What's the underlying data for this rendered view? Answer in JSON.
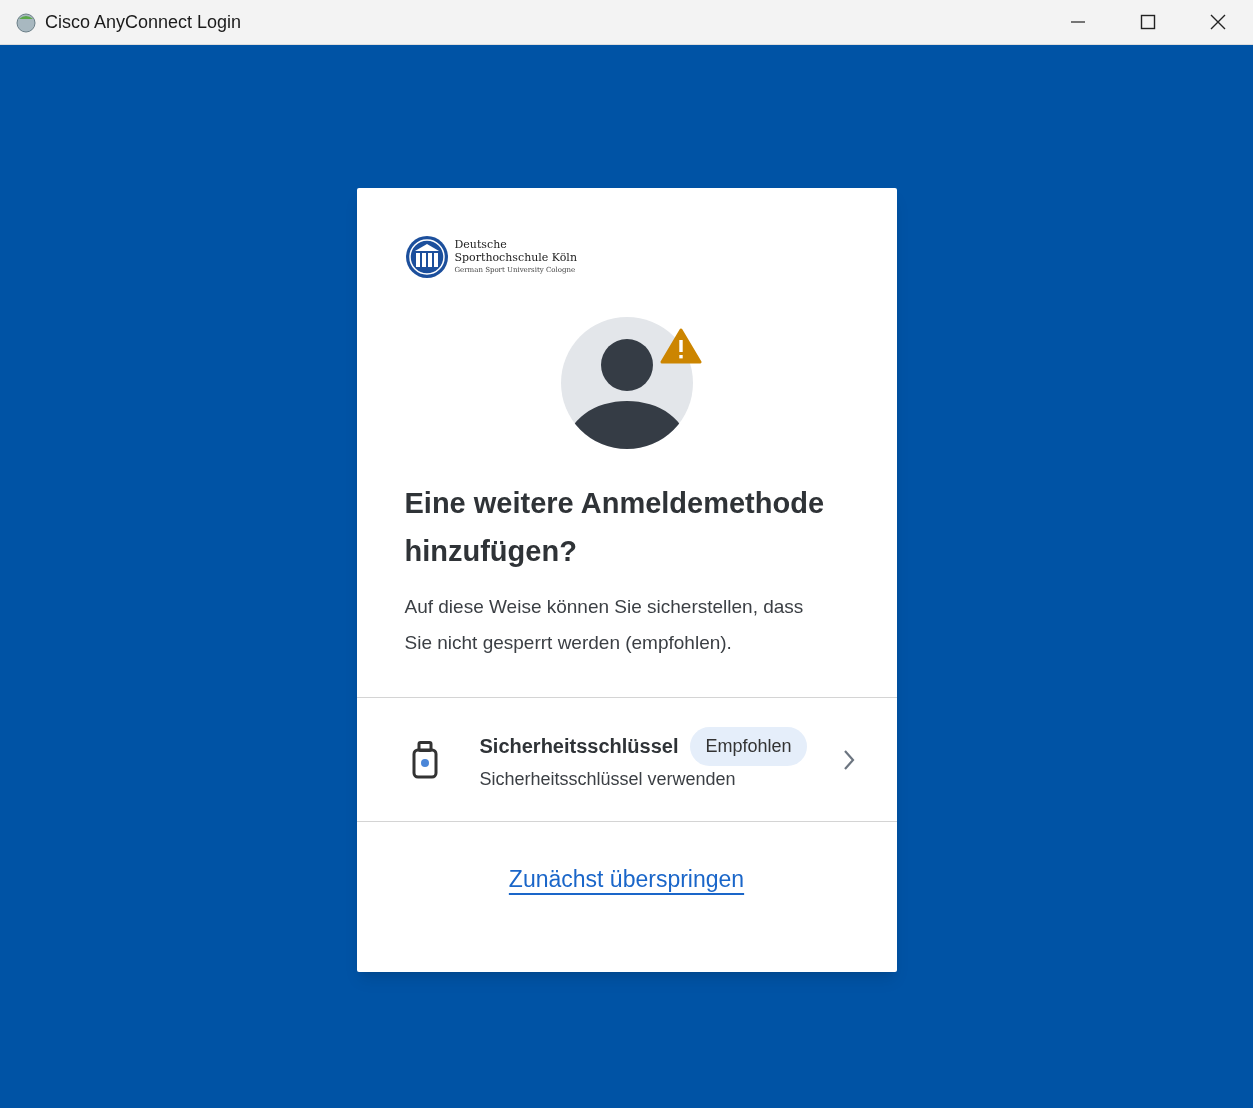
{
  "window": {
    "title": "Cisco AnyConnect Login"
  },
  "logo": {
    "lines": [
      "Deutsche",
      "Sporthochschule Köln",
      "German Sport University Cologne"
    ]
  },
  "heading": "Eine weitere Anmeldemethode hinzufügen?",
  "description": "Auf diese Weise können Sie sicherstellen, dass Sie nicht gesperrt werden (empfohlen).",
  "methods": [
    {
      "title": "Sicherheitsschlüssel",
      "badge": "Empfohlen",
      "subtitle": "Sicherheitsschlüssel verwenden"
    }
  ],
  "skip_link": "Zunächst überspringen"
}
